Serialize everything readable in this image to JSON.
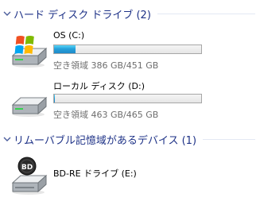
{
  "groups": [
    {
      "title": "ハード ディスク ドライブ (2)",
      "drives": [
        {
          "name": "OS (C:)",
          "free_text": "空き領域 386 GB/451 GB",
          "used_fraction": 0.144
        },
        {
          "name": "ローカル ディスク (D:)",
          "free_text": "空き領域 463 GB/465 GB",
          "used_fraction": 0.004
        }
      ]
    },
    {
      "title": "リムーバブル記憶域があるデバイス (1)",
      "drives": [
        {
          "name": "BD-RE ドライブ (E:)",
          "icon_label": "BD"
        }
      ]
    }
  ],
  "colors": {
    "group_title": "#1e3287",
    "bar_fill": "#26a0da",
    "free_text": "#6d6d6d"
  },
  "icons": [
    "windows-drive-icon",
    "hard-drive-icon",
    "bd-drive-icon",
    "chevron-down-icon"
  ]
}
